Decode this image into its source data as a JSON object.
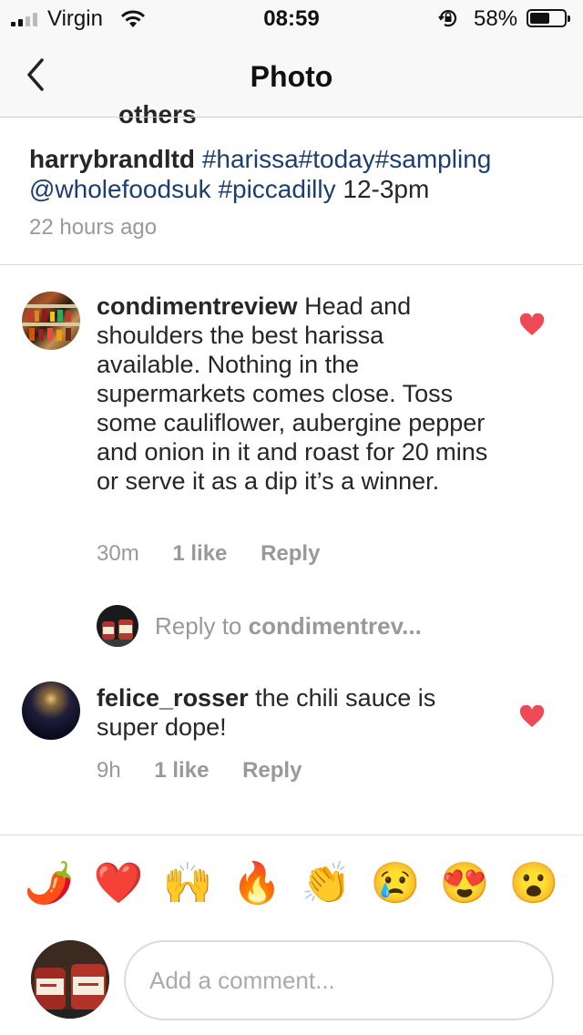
{
  "status": {
    "carrier": "Virgin",
    "time": "08:59",
    "battery": "58%",
    "battery_level": 0.58
  },
  "nav": {
    "title": "Photo"
  },
  "clipped_text": "others",
  "caption": {
    "username": "harrybrandltd",
    "hashtags": "#harissa#today#sampling",
    "mention": "@wholefoodsuk",
    "location_tag": "#piccadilly",
    "text_tail": " 12-3pm"
  },
  "time_ago": "22 hours ago",
  "comments": [
    {
      "username": "condimentreview",
      "text": " Head and shoulders the best harissa available. Nothing in the supermarkets comes close. Toss some cauliflower, aubergine pepper and onion in it and roast for 20 mins or serve it as a dip it’s a winner.",
      "age": "30m",
      "likes": "1 like",
      "reply": "Reply"
    },
    {
      "username": "felice_rosser",
      "text": " the chili sauce is super dope!",
      "age": "9h",
      "likes": "1 like",
      "reply": "Reply"
    }
  ],
  "reply_prompt": {
    "prefix": "Reply to ",
    "username": "condimentrev..."
  },
  "quick_emojis": [
    "🌶️",
    "❤️",
    "🙌",
    "🔥",
    "👏",
    "😢",
    "😍",
    "😮"
  ],
  "comment_input": {
    "placeholder": "Add a comment..."
  },
  "colors": {
    "like_heart": "#ed4956",
    "hashtag": "#1c3e6e",
    "meta_text": "#999999"
  }
}
